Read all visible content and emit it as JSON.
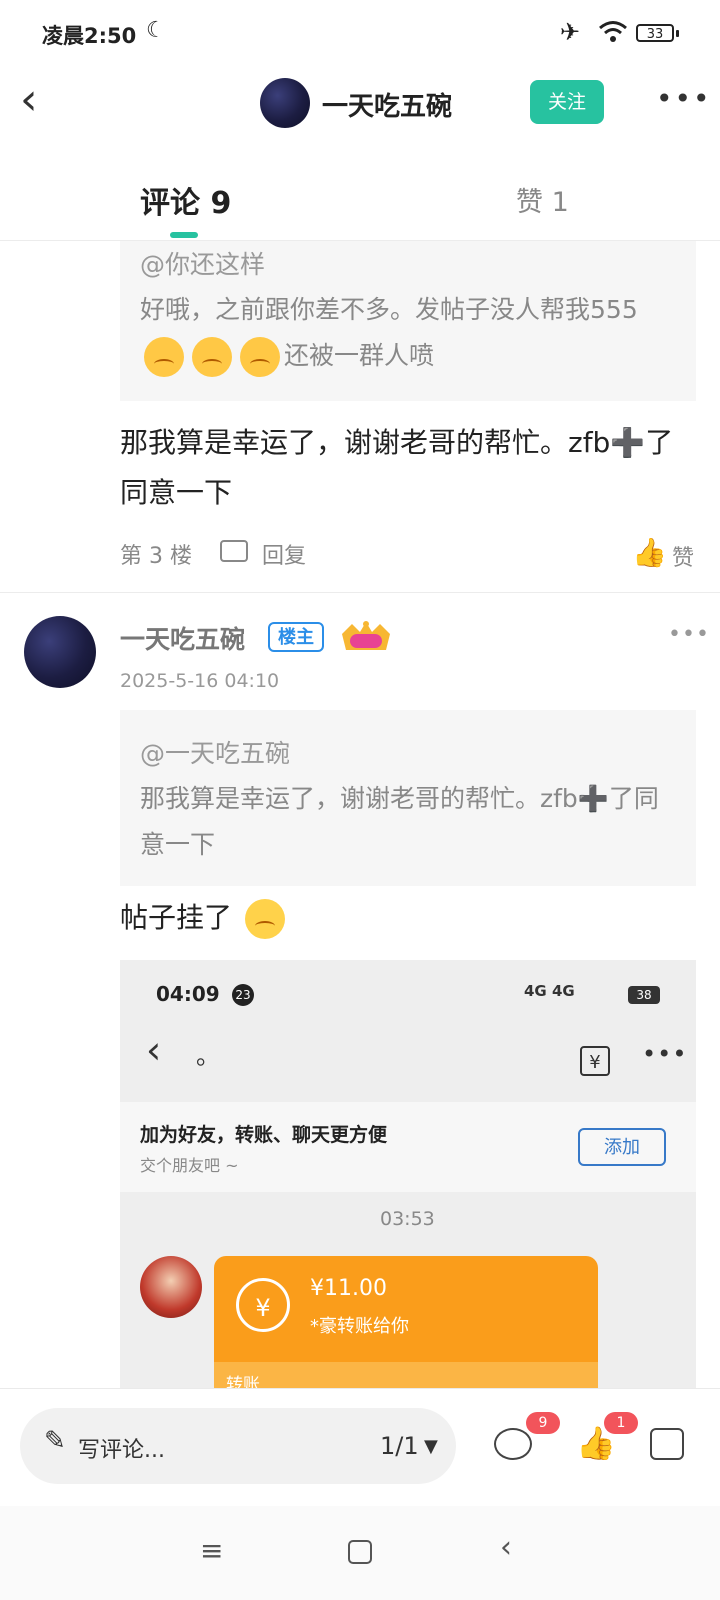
{
  "status_bar": {
    "time": "凌晨2:50",
    "battery": "33"
  },
  "header": {
    "back_icon": "chevron-left-icon",
    "username": "一天吃五碗",
    "follow_label": "关注",
    "more_icon": "more-icon"
  },
  "tabs": {
    "comments": "评论 9",
    "likes": "赞 1"
  },
  "comment1": {
    "quote_author": "@你还这样",
    "quote_text_before": "好哦，之前跟你差不多。发帖子没人帮我555",
    "quote_text_after": "还被一群人喷",
    "text": "那我算是幸运了，谢谢老哥的帮忙。zfb➕了同意一下",
    "floor": "第 3 楼",
    "reply_label": "回复",
    "like_label": "赞"
  },
  "comment2": {
    "username": "一天吃五碗",
    "badge": "楼主",
    "time": "2025-5-16 04:10",
    "quote_author": "@一天吃五碗",
    "quote_text": "那我算是幸运了，谢谢老哥的帮忙。zfb➕了同意一下",
    "text": "帖子挂了"
  },
  "embedded_screenshot": {
    "time": "04:09",
    "notif_count": "23",
    "signal": "4G 4G",
    "battery": "38",
    "title": "。",
    "banner_title": "加为好友，转账、聊天更方便",
    "banner_subtitle": "交个朋友吧 ~",
    "add_button": "添加",
    "message_time": "03:53",
    "transfer_amount": "¥11.00",
    "transfer_desc": "*豪转账给你",
    "transfer_label": "转账"
  },
  "bottom_bar": {
    "write_placeholder": "写评论...",
    "page_indicator": "1/1",
    "comment_count": "9",
    "like_count": "1"
  },
  "colors": {
    "accent": "#27c2a0",
    "badge_blue": "#2b8ee8",
    "alert_red": "#f2545b",
    "transfer_orange": "#fa9d1b"
  }
}
